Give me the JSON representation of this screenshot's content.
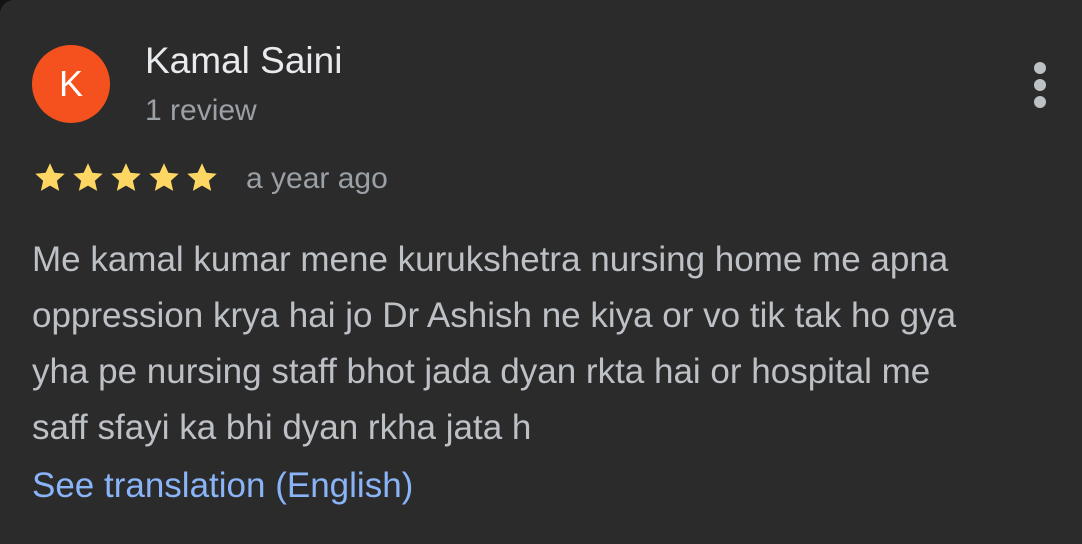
{
  "review": {
    "avatar_initial": "K",
    "avatar_color": "#f4511e",
    "reviewer_name": "Kamal Saini",
    "review_count": "1 review",
    "rating": 5,
    "max_rating": 5,
    "star_color": "#fdd663",
    "time_ago": "a year ago",
    "text_lines": [
      "Me kamal kumar mene kurukshetra nursing home me apna",
      "oppression krya hai jo Dr Ashish ne kiya or vo tik tak ho gya",
      "yha pe nursing staff bhot jada dyan rkta hai or hospital me",
      "saff sfayi ka bhi dyan rkha jata h"
    ],
    "translate_label": "See translation (English)",
    "more_icon": "more-vert-icon"
  }
}
